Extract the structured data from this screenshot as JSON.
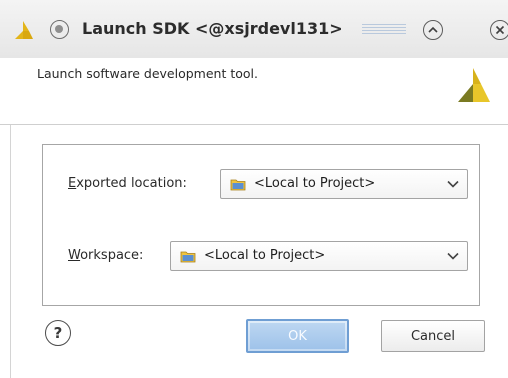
{
  "window": {
    "title": "Launch SDK <@xsjrdevl131>"
  },
  "header": {
    "description": "Launch software development tool."
  },
  "form": {
    "exported_location": {
      "label_mnemonic": "E",
      "label_rest": "xported location:",
      "value": "<Local to Project>"
    },
    "workspace": {
      "label_mnemonic": "W",
      "label_rest": "orkspace:",
      "value": "<Local to Project>"
    }
  },
  "buttons": {
    "help": "?",
    "ok": "OK",
    "cancel": "Cancel"
  },
  "icons": {
    "title_logo": "xilinx-logo-icon",
    "header_logo": "xilinx-logo-icon",
    "folder": "folder-icon",
    "dropdown": "chevron-down-icon"
  },
  "colors": {
    "brand_yellow": "#e6b800",
    "brand_olive": "#6b6b1e",
    "ok_button": "#a9c8ec"
  }
}
